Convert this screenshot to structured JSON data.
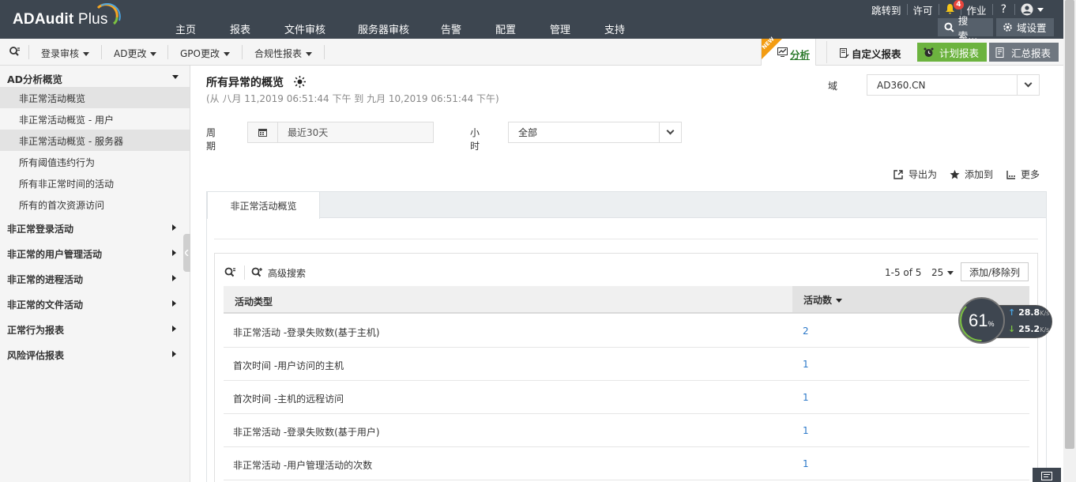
{
  "app": {
    "logo_text": "ADAudit",
    "logo_plus": "Plus"
  },
  "mainnav": [
    "主页",
    "报表",
    "文件审核",
    "服务器审核",
    "告警",
    "配置",
    "管理",
    "支持"
  ],
  "topright": {
    "jump": "跳转到",
    "license": "许可",
    "notif_count": "4",
    "jobs": "作业",
    "help": "?"
  },
  "header_buttons": {
    "search": "搜索...",
    "domain_settings": "域设置"
  },
  "subnav": [
    "登录审核",
    "AD更改",
    "GPO更改",
    "合规性报表"
  ],
  "toolbar": {
    "new_flag": "NEW",
    "analysis": "分析",
    "custom_report": "自定义报表",
    "schedule_report": "计划报表",
    "summary_report": "汇总报表"
  },
  "sidebar": {
    "section_title": "AD分析概览",
    "items": [
      "非正常活动概览",
      "非正常活动概览 - 用户",
      "非正常活动概览 - 服务器",
      "所有阈值违约行为",
      "所有非正常时间的活动",
      "所有的首次资源访问"
    ],
    "categories": [
      "非正常登录活动",
      "非正常的用户管理活动",
      "非正常的进程活动",
      "非正常的文件活动",
      "正常行为报表",
      "风险评估报表"
    ]
  },
  "page": {
    "title": "所有异常的概览",
    "range": "(从 八月 11,2019 06:51:44 下午 到 九月 10,2019 06:51:44 下午)",
    "domain_label": "域",
    "domain_value": "AD360.CN",
    "period_label": "周期",
    "period_value": "最近30天",
    "hour_label": "小时",
    "hour_value": "全部",
    "export": "导出为",
    "add_to": "添加到",
    "more": "更多"
  },
  "tab": {
    "label": "非正常活动概览"
  },
  "grid": {
    "advanced_search": "高级搜索",
    "paging": "1-5 of 5",
    "page_size": "25",
    "columns_button": "添加/移除列",
    "col1": "活动类型",
    "col2": "活动数",
    "rows": [
      {
        "type": "非正常活动 -登录失败数(基于主机)",
        "count": "2"
      },
      {
        "type": "首次时间 -用户访问的主机",
        "count": "1"
      },
      {
        "type": "首次时间 -主机的远程访问",
        "count": "1"
      },
      {
        "type": "非正常活动 -登录失败数(基于用户)",
        "count": "1"
      },
      {
        "type": "非正常活动 -用户管理活动的次数",
        "count": "1"
      }
    ]
  },
  "network_widget": {
    "percent": "61",
    "percent_sym": "%",
    "up": "28.8",
    "down": "25.2",
    "unit": "K/s"
  },
  "colors": {
    "header_bg": "#3d4650",
    "accent_green": "#6cb33f",
    "link_blue": "#2a77c8",
    "new_orange": "#f39c12"
  }
}
